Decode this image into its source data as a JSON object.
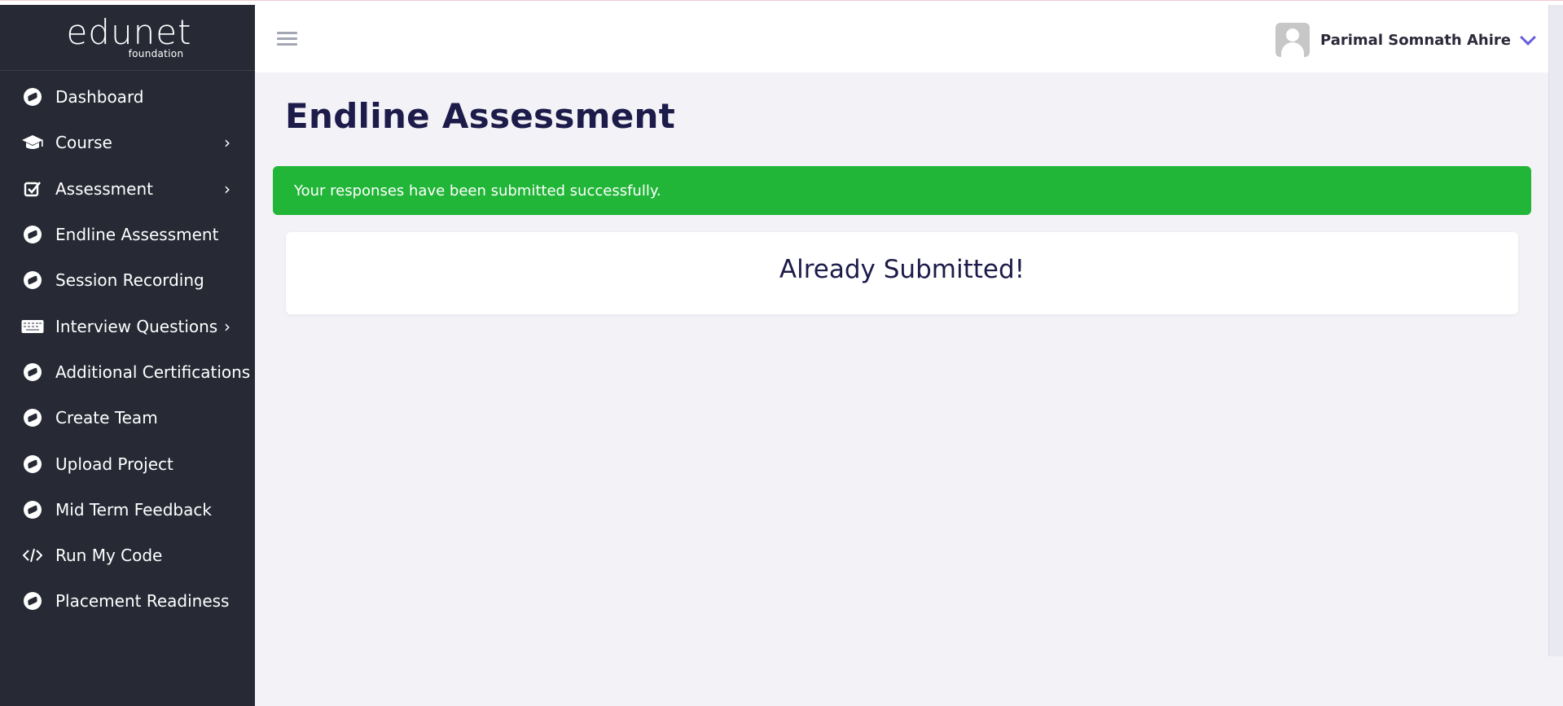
{
  "brand": {
    "name": "edunet",
    "sub": "foundation"
  },
  "sidebar": {
    "items": [
      {
        "label": "Dashboard",
        "icon": "compass-icon"
      },
      {
        "label": "Course",
        "icon": "graduation-cap-icon",
        "chevron": "›"
      },
      {
        "label": "Assessment",
        "icon": "check-square-icon",
        "chevron": "›"
      },
      {
        "label": "Endline Assessment",
        "icon": "compass-icon"
      },
      {
        "label": "Session Recording",
        "icon": "compass-icon"
      },
      {
        "label": "Interview Questions",
        "icon": "keyboard-icon",
        "chevron": "›"
      },
      {
        "label": "Additional Certifications",
        "icon": "compass-icon"
      },
      {
        "label": "Create Team",
        "icon": "compass-icon"
      },
      {
        "label": "Upload Project",
        "icon": "compass-icon"
      },
      {
        "label": "Mid Term Feedback",
        "icon": "compass-icon"
      },
      {
        "label": "Run My Code",
        "icon": "code-icon"
      },
      {
        "label": "Placement Readiness",
        "icon": "compass-icon"
      }
    ]
  },
  "header": {
    "user_name": "Parimal Somnath Ahire"
  },
  "main": {
    "title": "Endline Assessment",
    "alert": "Your responses have been submitted successfully.",
    "card_title": "Already Submitted!"
  },
  "colors": {
    "sidebar_bg": "#272a35",
    "alert_bg": "#22b638",
    "title": "#1c1b4a",
    "accent": "#6a5ed8"
  }
}
